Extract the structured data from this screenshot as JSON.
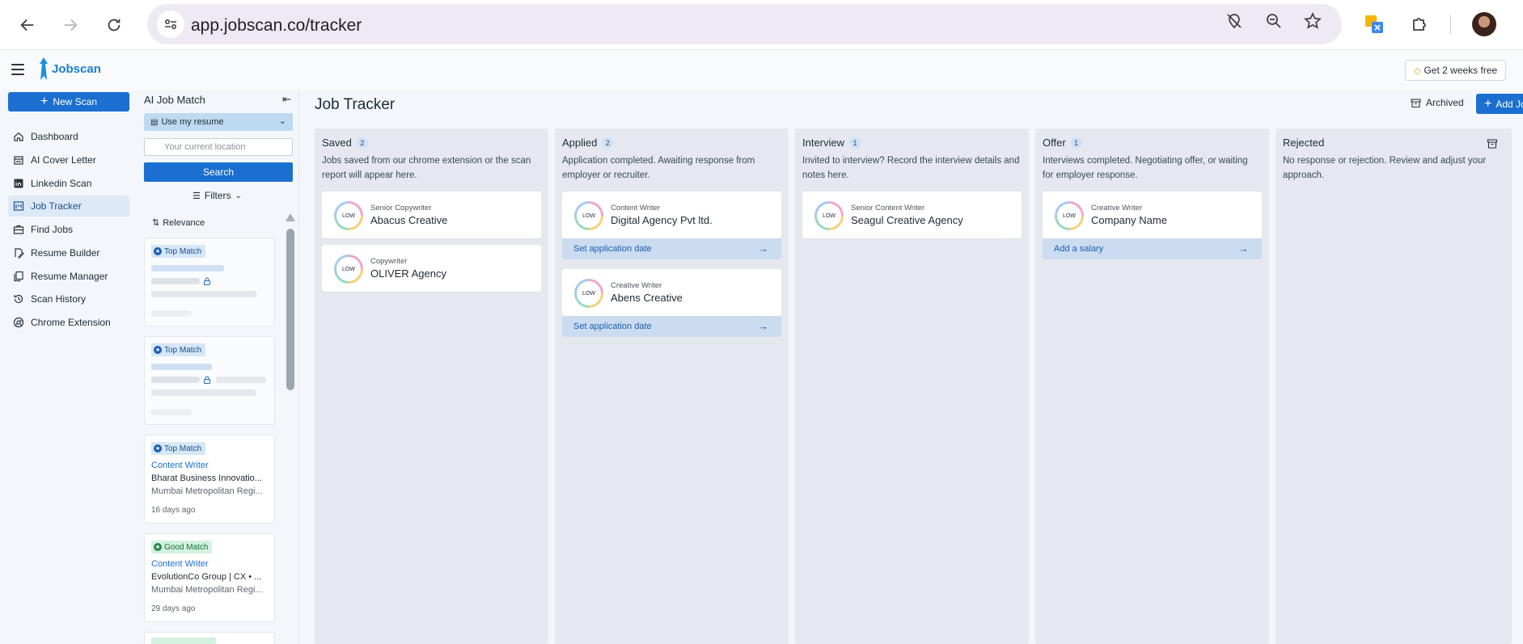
{
  "browser": {
    "url": "app.jobscan.co/tracker"
  },
  "header": {
    "logo_text": "Jobscan",
    "trial_button": "Get 2 weeks free"
  },
  "sidebar": {
    "new_scan": "New Scan",
    "items": [
      {
        "label": "Dashboard",
        "icon": "home-icon"
      },
      {
        "label": "AI Cover Letter",
        "icon": "envelope-icon"
      },
      {
        "label": "Linkedin Scan",
        "icon": "linkedin-icon"
      },
      {
        "label": "Job Tracker",
        "icon": "tracker-icon",
        "active": true
      },
      {
        "label": "Find Jobs",
        "icon": "briefcase-icon"
      },
      {
        "label": "Resume Builder",
        "icon": "document-edit-icon"
      },
      {
        "label": "Resume Manager",
        "icon": "copy-icon"
      },
      {
        "label": "Scan History",
        "icon": "history-icon"
      },
      {
        "label": "Chrome Extension",
        "icon": "chrome-icon"
      }
    ]
  },
  "match_panel": {
    "title": "AI Job Match",
    "resume_select": "Use my resume",
    "location_placeholder": "Your current location",
    "search": "Search",
    "filters": "Filters",
    "sort": "Relevance",
    "cards": [
      {
        "badge": "Top Match",
        "badge_type": "top",
        "blurred": true,
        "title": "",
        "company": "",
        "location": "",
        "age": ""
      },
      {
        "badge": "Top Match",
        "badge_type": "top",
        "blurred": true,
        "title": "",
        "company": "",
        "location": "",
        "age": ""
      },
      {
        "badge": "Top Match",
        "badge_type": "top",
        "blurred": false,
        "title": "Content Writer",
        "company": "Bharat Business Innovatio...",
        "location": "Mumbai Metropolitan Regi...",
        "age": "16 days ago"
      },
      {
        "badge": "Good Match",
        "badge_type": "good",
        "blurred": false,
        "title": "Content Writer",
        "company": "EvolutionCo Group | CX • ...",
        "location": "Mumbai Metropolitan Regi...",
        "age": "29 days ago"
      }
    ]
  },
  "board": {
    "title": "Job Tracker",
    "archived": "Archived",
    "add_button": "Add Job",
    "columns": [
      {
        "name": "Saved",
        "count": "2",
        "description": "Jobs saved from our chrome extension or the scan report will appear here.",
        "cards": [
          {
            "score": "LOW",
            "role": "Senior Copywriter",
            "company": "Abacus Creative",
            "action": ""
          },
          {
            "score": "LOW",
            "role": "Copywriter",
            "company": "OLIVER Agency",
            "action": ""
          }
        ]
      },
      {
        "name": "Applied",
        "count": "2",
        "description": "Application completed. Awaiting response from employer or recruiter.",
        "cards": [
          {
            "score": "LOW",
            "role": "Content Writer",
            "company": "Digital Agency Pvt ltd.",
            "action": "Set application date"
          },
          {
            "score": "LOW",
            "role": "Creative Writer",
            "company": "Abens Creative",
            "action": "Set application date"
          }
        ]
      },
      {
        "name": "Interview",
        "count": "1",
        "description": "Invited to interview? Record the interview details and notes here.",
        "cards": [
          {
            "score": "LOW",
            "role": "Senior Content Writer",
            "company": "Seagul Creative Agency",
            "action": ""
          }
        ]
      },
      {
        "name": "Offer",
        "count": "1",
        "description": "Interviews completed. Negotiating offer, or waiting for employer response.",
        "cards": [
          {
            "score": "LOW",
            "role": "Creative Writer",
            "company": "Company Name",
            "action": "Add a salary"
          }
        ]
      },
      {
        "name": "Rejected",
        "count": "",
        "description": "No response or rejection. Review and adjust your approach.",
        "cards": []
      }
    ]
  }
}
